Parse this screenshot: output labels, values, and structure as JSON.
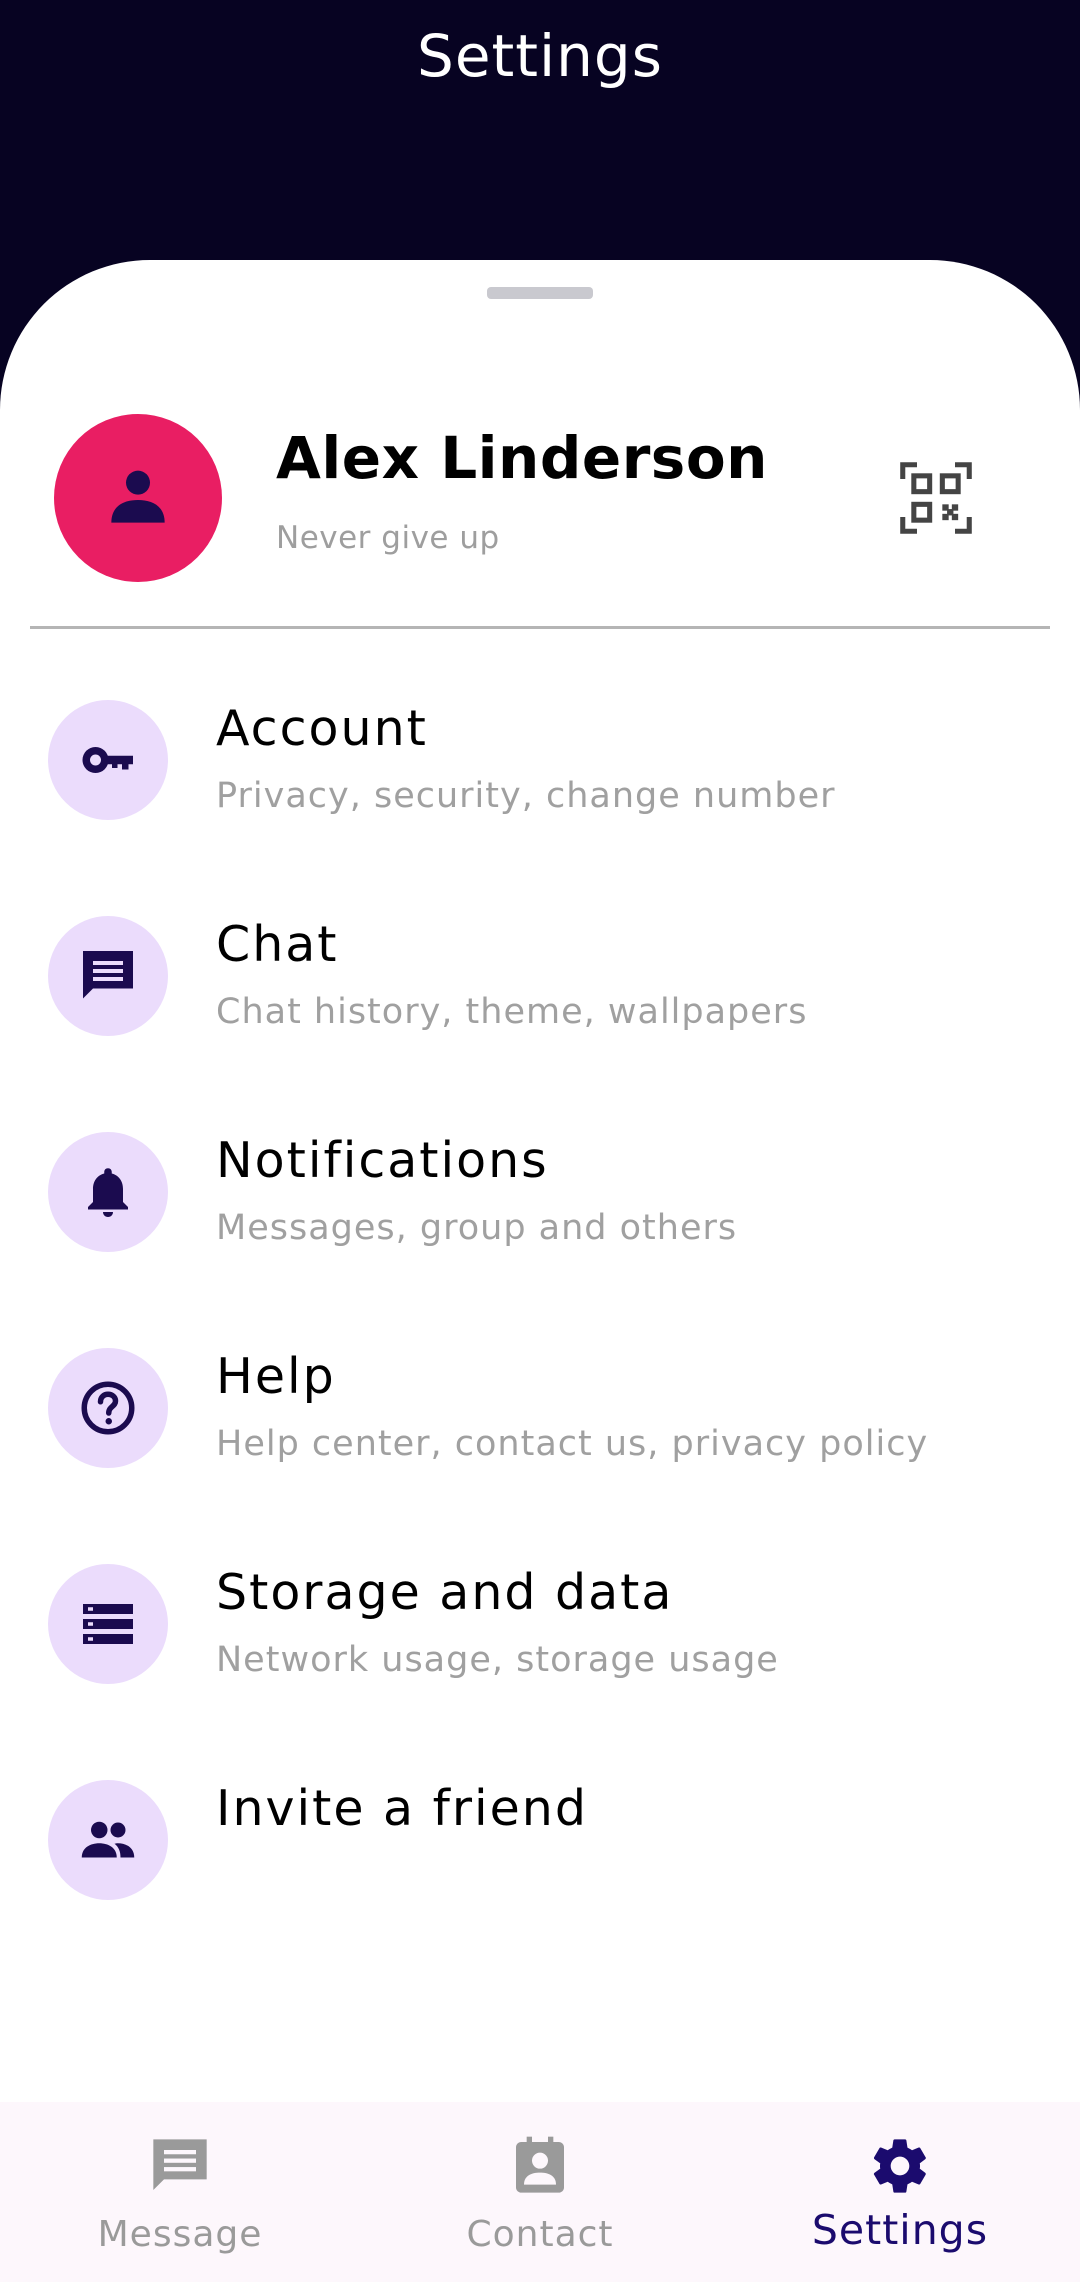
{
  "header": {
    "title": "Settings"
  },
  "profile": {
    "name": "Alex Linderson",
    "status": "Never give up"
  },
  "menu": {
    "items": [
      {
        "title": "Account",
        "subtitle": "Privacy, security, change number",
        "icon": "key-icon"
      },
      {
        "title": "Chat",
        "subtitle": "Chat history, theme, wallpapers",
        "icon": "chat-icon"
      },
      {
        "title": "Notifications",
        "subtitle": "Messages, group and others",
        "icon": "bell-icon"
      },
      {
        "title": "Help",
        "subtitle": "Help center, contact us, privacy policy",
        "icon": "help-icon"
      },
      {
        "title": "Storage and data",
        "subtitle": "Network usage, storage usage",
        "icon": "storage-icon"
      },
      {
        "title": "Invite a friend",
        "subtitle": "",
        "icon": "people-icon"
      }
    ]
  },
  "bottom_nav": {
    "items": [
      {
        "label": "Message",
        "icon": "message-icon",
        "active": false
      },
      {
        "label": "Contact",
        "icon": "contact-icon",
        "active": false
      },
      {
        "label": "Settings",
        "icon": "gear-icon",
        "active": true
      }
    ]
  },
  "colors": {
    "header_bg": "#070322",
    "avatar_bg": "#e91e63",
    "icon_circle_bg": "#ebdcfc",
    "icon_color": "#1b0b4f",
    "active_nav": "#1b0b6e",
    "inactive_nav": "#9a9a9a"
  }
}
